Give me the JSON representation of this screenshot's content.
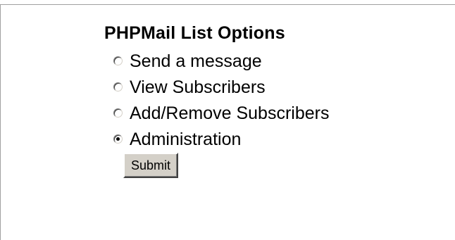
{
  "form": {
    "title": "PHPMail List Options",
    "options": [
      {
        "label": "Send a message",
        "checked": false
      },
      {
        "label": "View Subscribers",
        "checked": false
      },
      {
        "label": "Add/Remove Subscribers",
        "checked": false
      },
      {
        "label": "Administration",
        "checked": true
      }
    ],
    "submit_label": "Submit"
  }
}
